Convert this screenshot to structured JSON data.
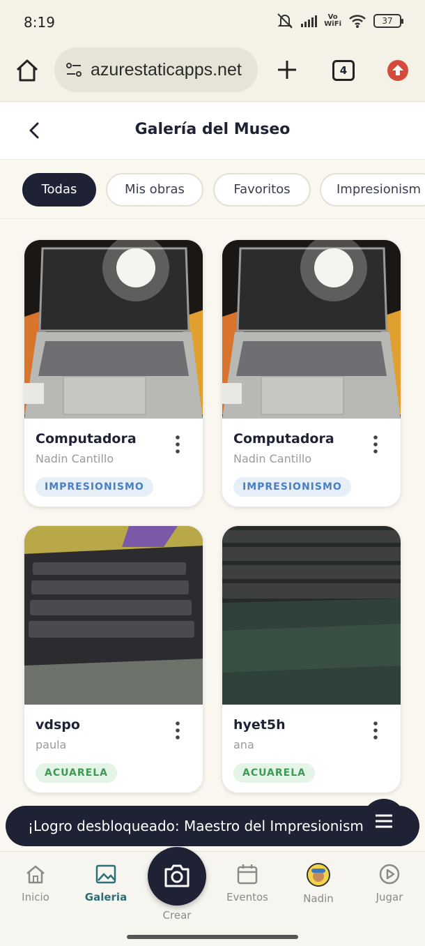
{
  "status_bar": {
    "time": "8:19",
    "wifi_label_top": "Vo",
    "wifi_label_bottom": "WiFi",
    "battery": "37"
  },
  "browser": {
    "url": "azurestaticapps.net",
    "tab_count": "4"
  },
  "header": {
    "title": "Galería del Museo"
  },
  "filters": [
    {
      "label": "Todas",
      "active": true
    },
    {
      "label": "Mis obras",
      "active": false
    },
    {
      "label": "Favoritos",
      "active": false
    },
    {
      "label": "Impresionism",
      "active": false
    }
  ],
  "cards": [
    {
      "title": "Computadora",
      "author": "Nadin Cantillo",
      "tag": "IMPRESIONISMO",
      "image": "laptop-photo"
    },
    {
      "title": "Computadora",
      "author": "Nadin Cantillo",
      "tag": "IMPRESIONISMO",
      "image": "laptop-photo"
    },
    {
      "title": "vdspo",
      "author": "paula",
      "tag": "ACUARELA",
      "image": "keyboard-photo"
    },
    {
      "title": "hyet5h",
      "author": "ana",
      "tag": "ACUARELA",
      "image": "keyboard-photo"
    }
  ],
  "toast": {
    "message": "¡Logro desbloqueado: Maestro del Impresionismo"
  },
  "bottom_nav": {
    "items": [
      {
        "label": "Inicio",
        "icon": "home-icon"
      },
      {
        "label": "Galeria",
        "icon": "image-icon",
        "active": true
      },
      {
        "label": "Crear",
        "icon": "camera-icon"
      },
      {
        "label": "Eventos",
        "icon": "calendar-icon"
      },
      {
        "label": "Nadin",
        "icon": "avatar"
      },
      {
        "label": "Jugar",
        "icon": "play-icon"
      }
    ]
  },
  "colors": {
    "accent": "#1f2235",
    "active_nav": "#2d6e78",
    "tag_impresionismo": "#4a7fc1",
    "tag_acuarela": "#3c9a55"
  }
}
